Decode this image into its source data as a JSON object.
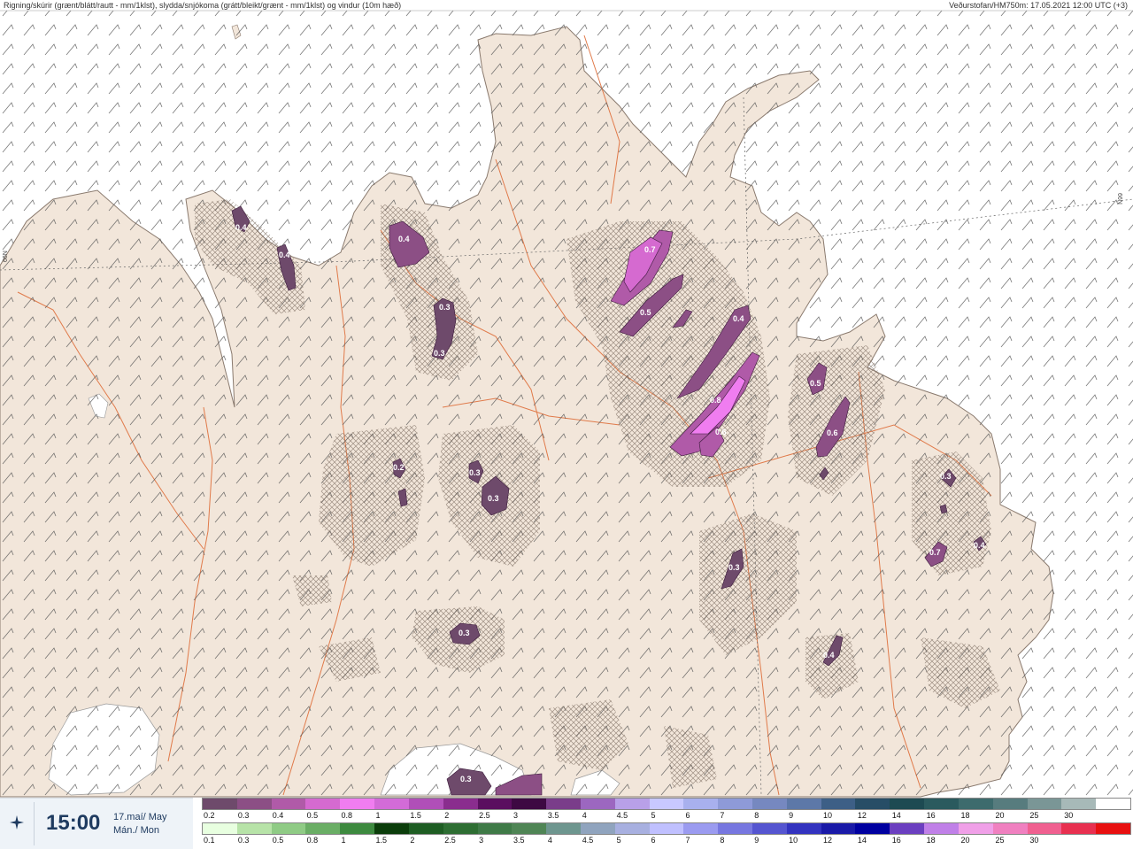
{
  "header": {
    "title": "Rigning/skúrir (grænt/blátt/rautt - mm/1klst), slydda/snjókoma (grátt/bleikt/grænt - mm/1klst) og vindur (10m hæð)",
    "source": "Veðurstofan/HM750m: 17.05.2021 12:00 UTC (+3)"
  },
  "graticule": {
    "left_label": "66N",
    "right_label": "66N"
  },
  "footer": {
    "time": "15:00",
    "date_line1": "17.maí/ May",
    "date_line2": "Mán./ Mon",
    "icon": "compass-star-icon"
  },
  "contour_labels": [
    "0.4",
    "0.4",
    "0.4",
    "0.3",
    "0.3",
    "0.7",
    "0.5",
    "0.4",
    "0.8",
    "0.6",
    "0.5",
    "0.6",
    "0.2",
    "0.3",
    "0.3",
    "0.3",
    "0.3",
    "0.3",
    "0.7",
    "0.4",
    "0.3",
    "0.4"
  ],
  "legend_snow": {
    "colors": [
      "#6e4a6b",
      "#8c4f85",
      "#b05aa8",
      "#d56ad0",
      "#f07df0",
      "#d36bd8",
      "#b04fb8",
      "#8a2d8e",
      "#5a0f5f",
      "#3d0942",
      "#7a3d8a",
      "#9c67c0",
      "#b8a0e8",
      "#c8c8ff",
      "#a8b0ee",
      "#8e9ad8",
      "#7688c0",
      "#5d78a8",
      "#3d5f86",
      "#274d66",
      "#1d4a52",
      "#2a5a5e",
      "#3d6b6d",
      "#577c7e",
      "#7a9696",
      "#a7b9b8",
      "#ffffff"
    ],
    "ticks": [
      "0.2",
      "0.3",
      "0.4",
      "0.5",
      "0.8",
      "1",
      "1.5",
      "2",
      "2.5",
      "3",
      "3.5",
      "4",
      "4.5",
      "5",
      "6",
      "7",
      "8",
      "9",
      "10",
      "12",
      "14",
      "16",
      "18",
      "20",
      "25",
      "30"
    ]
  },
  "legend_rain": {
    "colors": [
      "#e8ffe0",
      "#b7e3a8",
      "#8fcb85",
      "#6aae65",
      "#3d8a3f",
      "#0b3d0b",
      "#1e5d23",
      "#2e6e33",
      "#3f7a47",
      "#4f8555",
      "#6e968f",
      "#90a4be",
      "#a8b0e0",
      "#c0c0ff",
      "#9b9bf0",
      "#7777e0",
      "#5555d0",
      "#3333bf",
      "#1a1aa8",
      "#0000a0",
      "#6b3fc0",
      "#c080e8",
      "#f0a0e8",
      "#f080c0",
      "#f06090",
      "#e83050",
      "#e81010"
    ],
    "ticks": [
      "0.1",
      "0.3",
      "0.5",
      "0.8",
      "1",
      "1.5",
      "2",
      "2.5",
      "3",
      "3.5",
      "4",
      "4.5",
      "5",
      "6",
      "7",
      "8",
      "9",
      "10",
      "12",
      "14",
      "16",
      "18",
      "20",
      "25",
      "30"
    ]
  }
}
